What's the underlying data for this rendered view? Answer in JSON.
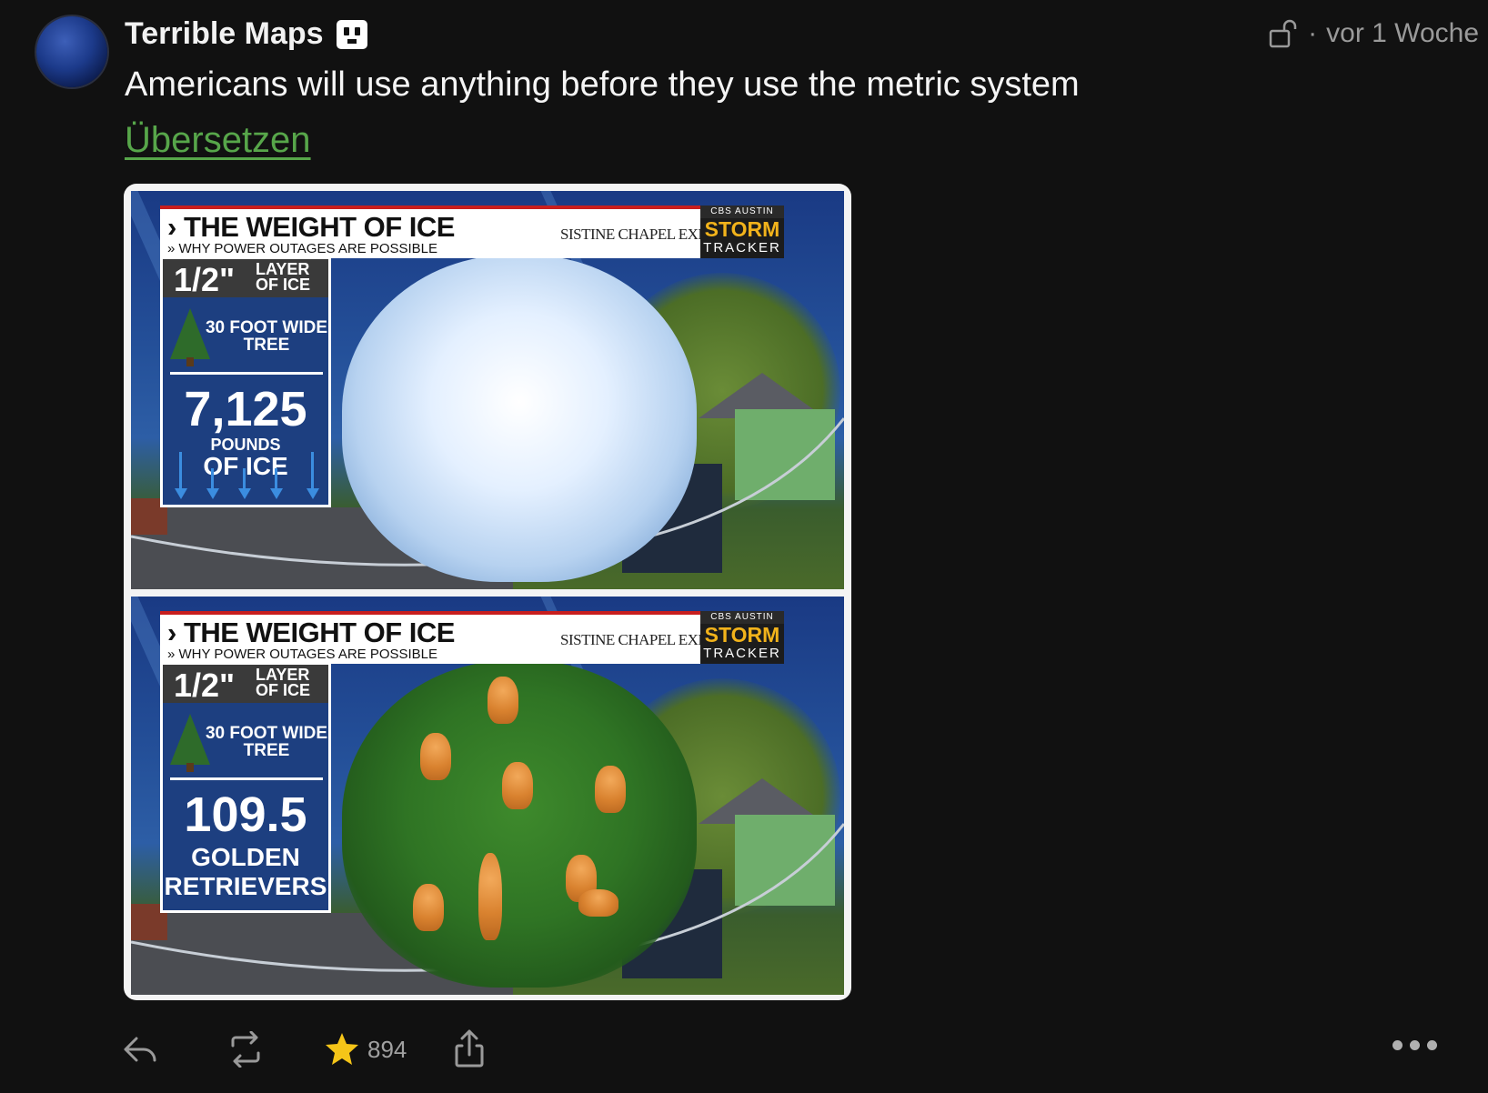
{
  "post": {
    "author": "Terrible Maps",
    "time": "vor 1 Woche",
    "text": "Americans will use anything before they use the metric system",
    "translate_label": "Übersetzen"
  },
  "media": {
    "panels": [
      {
        "title": "THE WEIGHT OF ICE",
        "subtitle": "WHY POWER OUTAGES ARE POSSIBLE",
        "sponsor": "SISTINE CHAPEL EXPERIENCE",
        "logo_top": "CBS AUSTIN",
        "logo_main": "STORM",
        "logo_bottom": "TRACKER",
        "layer_value": "1/2\"",
        "layer_label": "LAYER OF ICE",
        "tree_label": "30 FOOT WIDE TREE",
        "big_value": "7,125",
        "unit_small": "POUNDS",
        "unit_large": "OF ICE"
      },
      {
        "title": "THE WEIGHT OF ICE",
        "subtitle": "WHY POWER OUTAGES ARE POSSIBLE",
        "sponsor": "SISTINE CHAPEL EXPERIENCE",
        "logo_top": "CBS AUSTIN",
        "logo_main": "STORM",
        "logo_bottom": "TRACKER",
        "layer_value": "1/2\"",
        "layer_label": "LAYER OF ICE",
        "tree_label": "30 FOOT WIDE TREE",
        "big_value": "109.5",
        "unit_line1": "GOLDEN",
        "unit_line2": "RETRIEVERS"
      }
    ]
  },
  "actions": {
    "favourites_count": "894",
    "icons": [
      "reply-icon",
      "boost-icon",
      "star-icon",
      "share-icon",
      "more-icon"
    ]
  },
  "colors": {
    "background": "#111111",
    "link_green": "#57a64a",
    "star": "#f5c518"
  }
}
